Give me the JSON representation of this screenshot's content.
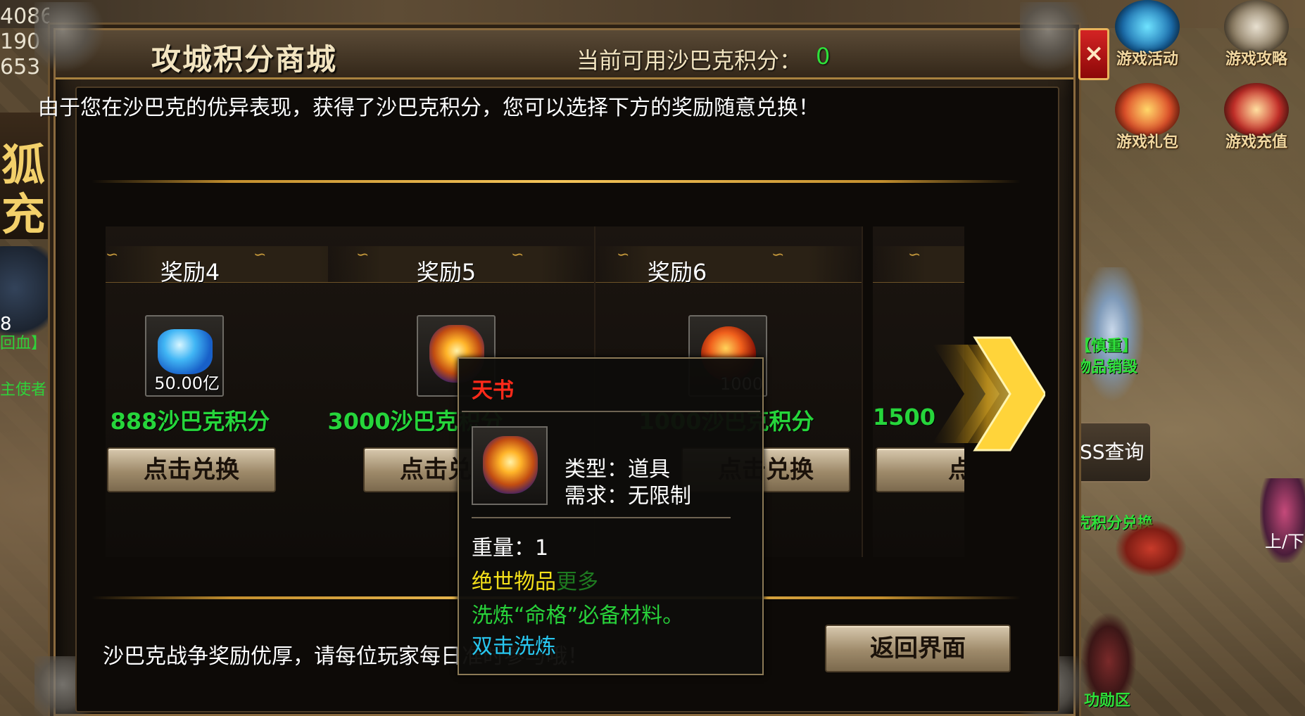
{
  "world": {
    "left_stats": [
      "4086",
      "190",
      "653"
    ],
    "left_glyph": "狐充",
    "left_level": "8",
    "left_green_1": "回血】",
    "left_green_2": "主使者"
  },
  "hud": {
    "game_activity": "游戏活动",
    "game_guide": "游戏攻略",
    "game_gift": "游戏礼包",
    "game_recharge": "游戏充值",
    "npc_tag_1": "【慎重】",
    "npc_tag_2": "物品销毁",
    "boss_query": "SS查询",
    "exchange_tag": "克积分兑换",
    "updown": "上/下",
    "red_tag": "功勋区",
    "close": "×"
  },
  "modal": {
    "title": "攻城积分商城",
    "points_label": "当前可用沙巴克积分：",
    "points_value": "0",
    "intro": "由于您在沙巴克的优异表现，获得了沙巴克积分，您可以选择下方的奖励随意兑换！",
    "footer": "沙巴克战争奖励优厚，请每位玩家每日准时参与哦！",
    "return_button": "返回界面"
  },
  "rewards": [
    {
      "title": "奖励4",
      "item_icon": "blue-gem-icon",
      "quantity": "50.00亿",
      "cost": "888沙巴克积分",
      "button": "点击兑换"
    },
    {
      "title": "奖励5",
      "item_icon": "golden-crown-icon",
      "quantity": "",
      "cost": "3000沙巴克积分",
      "button": "点击兑换"
    },
    {
      "title": "奖励6",
      "item_icon": "fire-orb-icon",
      "quantity": "1000",
      "cost": "1000沙巴克积分",
      "button": "点击兑换"
    },
    {
      "title": "",
      "item_icon": "",
      "quantity": "",
      "cost": "1500",
      "button": "点"
    }
  ],
  "tooltip": {
    "name": "天书",
    "type_line": "类型：道具",
    "req_line": "需求：无限制",
    "weight_line": "重量：1",
    "rarity": "绝世物品",
    "more": "更多",
    "desc": "洗炼“命格”必备材料。",
    "action": "双击洗炼"
  },
  "colors": {
    "accent_gold": "#f5c55a",
    "cost_green": "#26d53b",
    "close_red": "#d42424",
    "tooltip_name_red": "#ff2a1a",
    "rarity_yellow": "#f4e01a",
    "action_cyan": "#28c7f0"
  }
}
